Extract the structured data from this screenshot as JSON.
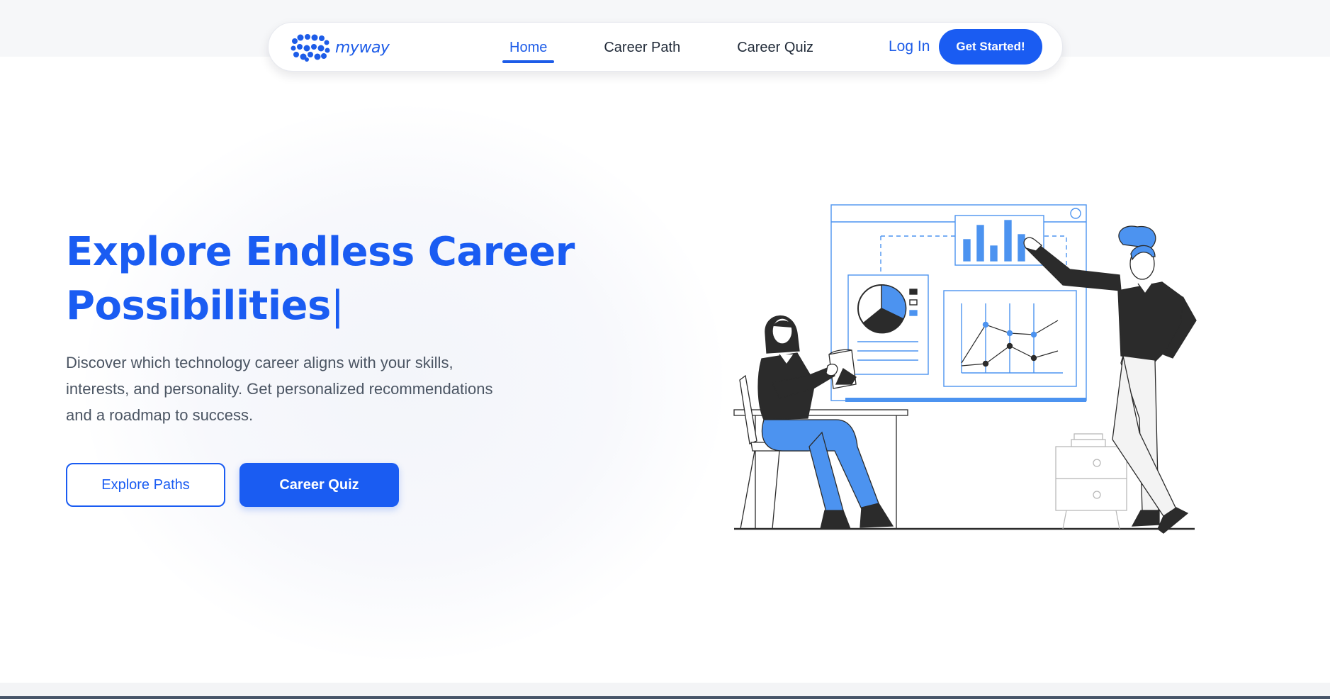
{
  "nav": {
    "logo_text": "myway",
    "links": [
      {
        "label": "Home",
        "active": true
      },
      {
        "label": "Career Path",
        "active": false
      },
      {
        "label": "Career Quiz",
        "active": false
      }
    ],
    "login_label": "Log In",
    "cta_label": "Get Started!"
  },
  "hero": {
    "title": "Explore Endless Career Possibilities",
    "cursor": "|",
    "description": "Discover which technology career aligns with your skills, interests, and personality. Get personalized recommendations and a roadmap to success.",
    "primary_button": "Career Quiz",
    "secondary_button": "Explore Paths"
  },
  "colors": {
    "accent": "#1a5cf2",
    "illustration_blue": "#4c93f0",
    "ink": "#2b2b2b"
  },
  "icons": {
    "logo": "myway-logo-icon",
    "illustration": "career-presentation-illustration"
  }
}
